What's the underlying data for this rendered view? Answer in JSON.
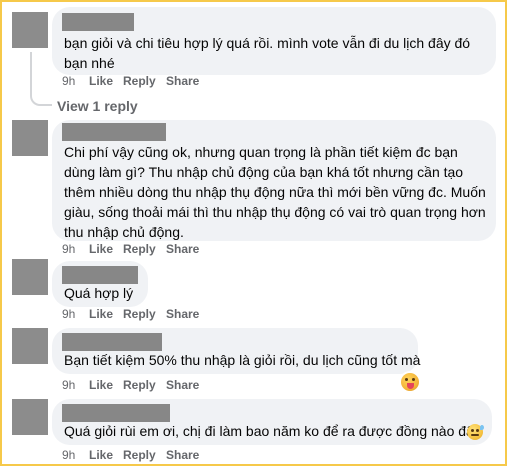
{
  "comments": [
    {
      "text": "bạn giỏi và chi tiêu hợp lý quá rồi. mình vote vẫn đi du lịch đây đó bạn nhé",
      "time": "9h",
      "like": "Like",
      "reply": "Reply",
      "share": "Share",
      "view_replies": "View 1 reply"
    },
    {
      "text": "Chi phí vậy cũng ok, nhưng quan trọng là phần tiết kiệm đc bạn dùng làm gì? Thu nhập chủ động của bạn khá tốt nhưng cần tạo thêm nhiều dòng thu nhập thụ động nữa thì mới bền vững đc. Muốn giàu, sống thoải mái thì thu nhập thụ động có vai trò quan trọng hơn thu nhập chủ động.",
      "time": "9h",
      "like": "Like",
      "reply": "Reply",
      "share": "Share"
    },
    {
      "text": "Quá hợp lý",
      "time": "9h",
      "like": "Like",
      "reply": "Reply",
      "share": "Share"
    },
    {
      "text": "Bạn tiết kiệm 50% thu nhập là giỏi rồi, du lịch cũng tốt mà",
      "time": "9h",
      "like": "Like",
      "reply": "Reply",
      "share": "Share",
      "reaction_icon": "tongue-out-emoji-icon"
    },
    {
      "text": "Quá giỏi rùi em ơi, chị đi làm bao năm ko để ra được đồng nào đây",
      "time": "9h",
      "like": "Like",
      "reply": "Reply",
      "share": "Share",
      "inline_emoji": "sweat-smile-emoji-icon"
    }
  ],
  "colors": {
    "border": "#f6c94a",
    "bubble": "#f0f2f5",
    "meta_text": "#65676b",
    "redaction": "#878787"
  }
}
